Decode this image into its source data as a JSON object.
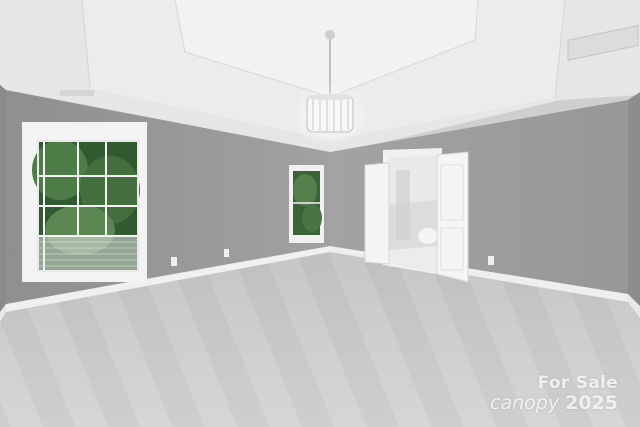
{
  "scene": {
    "description_free": true,
    "colors": {
      "wall": "#9c9c9c",
      "ceiling": "#ebebeb",
      "carpet": "#cdcdcd",
      "trim": "#f2f2f2",
      "foliage": "#3f6a3b"
    }
  },
  "watermark": {
    "line1": "For Sale",
    "brand": "canopy",
    "year": "2025"
  }
}
